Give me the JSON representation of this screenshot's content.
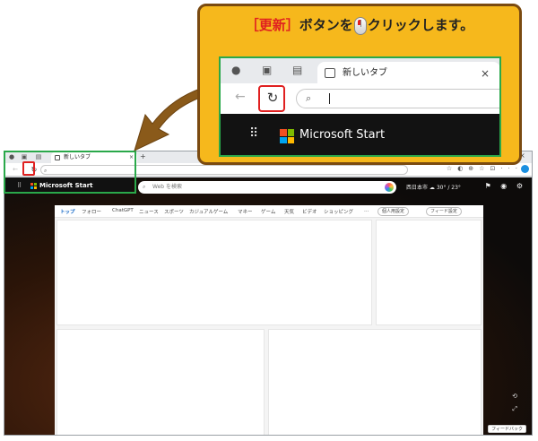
{
  "callout": {
    "bracket_label": "［更新］",
    "text_before_mouse": "ボタンを",
    "text_after_mouse": "クリックします。"
  },
  "zoom": {
    "tab_title": "新しいタブ",
    "close_symbol": "×",
    "back_arrow": "←",
    "reload_symbol": "↻",
    "search_symbol": "⌕",
    "apps_symbol": "⠿",
    "brand_text": "Microsoft Start"
  },
  "browser": {
    "tab_title": "新しいタブ",
    "close_symbol": "×",
    "newtab_symbol": "+",
    "reload_symbol": "↻",
    "search_symbol": "⌕",
    "brand_text": "Microsoft Start",
    "search_placeholder": "Web を検索",
    "weather": "西日本市  ☁  30° / 23°",
    "nav_items": [
      "トップ",
      "フォロー",
      "ChatGPT",
      "ニュース",
      "スポーツ",
      "カジュアルゲーム",
      "マネー",
      "ゲーム",
      "天気",
      "ビデオ",
      "ショッピング",
      "…"
    ],
    "personalize_label": "個人用設定",
    "feed_settings_label": "フィード設定",
    "feedback_label": "フィードバック"
  },
  "colors": {
    "callout_bg": "#f6b81c",
    "highlight_red": "#e02020",
    "highlight_green": "#2aa84a",
    "ms_red": "#f25022",
    "ms_green": "#7fba00",
    "ms_blue": "#00a4ef",
    "ms_yellow": "#ffb900"
  }
}
